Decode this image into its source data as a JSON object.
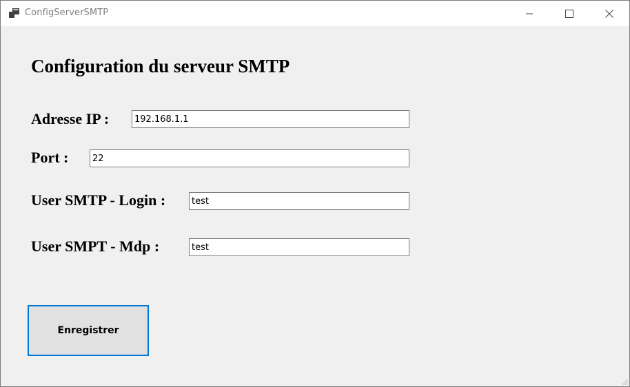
{
  "window": {
    "title": "ConfigServerSMTP",
    "icon": "app-windows-icon",
    "caption_icons": [
      "minimize-icon",
      "maximize-icon",
      "close-icon"
    ]
  },
  "form": {
    "heading": "Configuration du serveur SMTP",
    "fields": {
      "ip": {
        "label": "Adresse IP :",
        "value": "192.168.1.1"
      },
      "port": {
        "label": "Port :",
        "value": "22"
      },
      "login": {
        "label": "User SMTP - Login :",
        "value": "test"
      },
      "mdp": {
        "label": "User SMPT - Mdp :",
        "value": "test"
      }
    },
    "save_label": "Enregistrer"
  },
  "colors": {
    "window_bg": "#f0f0f0",
    "titlebar_bg": "#ffffff",
    "focus_border": "#0078d7",
    "button_bg": "#e1e1e1"
  }
}
